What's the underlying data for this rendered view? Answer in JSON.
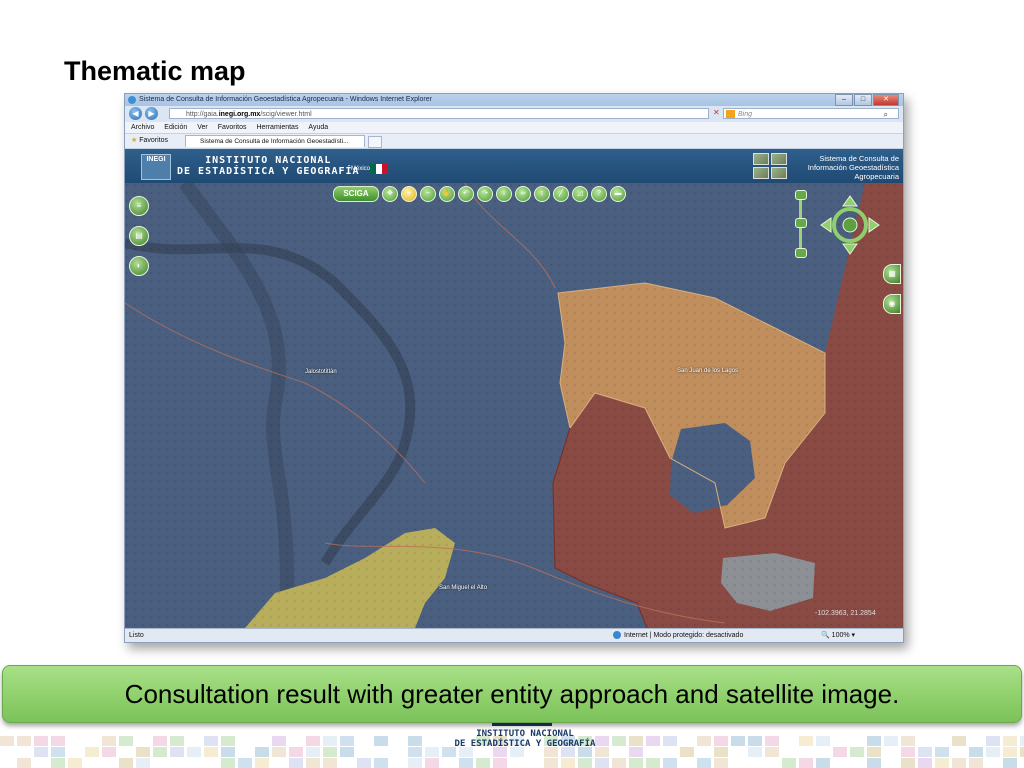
{
  "slide": {
    "title": "Thematic map",
    "caption": "Consultation result with greater entity approach and satellite image."
  },
  "browser": {
    "window_title": "Sistema de Consulta de Información Geoestadística Agropecuaria - Windows Internet Explorer",
    "url_prefix": "http://gaia.",
    "url_domain": "inegi.org.mx",
    "url_path": "/scig/viewer.html",
    "search_placeholder": "Bing",
    "menu": [
      "Archivo",
      "Edición",
      "Ver",
      "Favoritos",
      "Herramientas",
      "Ayuda"
    ],
    "favorites_label": "Favoritos",
    "tab_label": "Sistema de Consulta de Información Geoestadísti...",
    "status_left": "Listo",
    "status_zone": "Internet | Modo protegido: desactivado",
    "status_zoom": "100%"
  },
  "site": {
    "logo_text": "INEGI",
    "institute_line1": "INSTITUTO NACIONAL",
    "institute_line2": "DE ESTADÍSTICA Y GEOGRAFÍA",
    "country": "México",
    "system_name_line1": "Sistema de Consulta de",
    "system_name_line2": "Información Geoestadística",
    "system_name_line3": "Agropecuaria"
  },
  "toolbar": {
    "scig_label": "SCIGA",
    "tools": [
      "pan-tool",
      "zoom-in-tool",
      "zoom-out-tool",
      "hand-tool",
      "back-tool",
      "forward-tool",
      "info-tool",
      "binoculars-tool",
      "measure-tool",
      "line-tool",
      "area-tool",
      "help-tool",
      "print-tool"
    ],
    "active_tool": "zoom-in-tool"
  },
  "map": {
    "place_labels": [
      "San Juan de los Lagos",
      "Jalostotitlán",
      "San Miguel el Alto"
    ],
    "coordinates": "-102.3963, 21.2854",
    "region_colors": {
      "blue": "#4a5f7f",
      "orange": "#c08d5c",
      "red": "#8a4a44",
      "yellow": "#b8ad5a",
      "gray": "#8c8f94"
    }
  },
  "footer": {
    "line1": "INSTITUTO NACIONAL",
    "line2": "DE ESTADÍSTICA Y GEOGRAFÍA"
  }
}
